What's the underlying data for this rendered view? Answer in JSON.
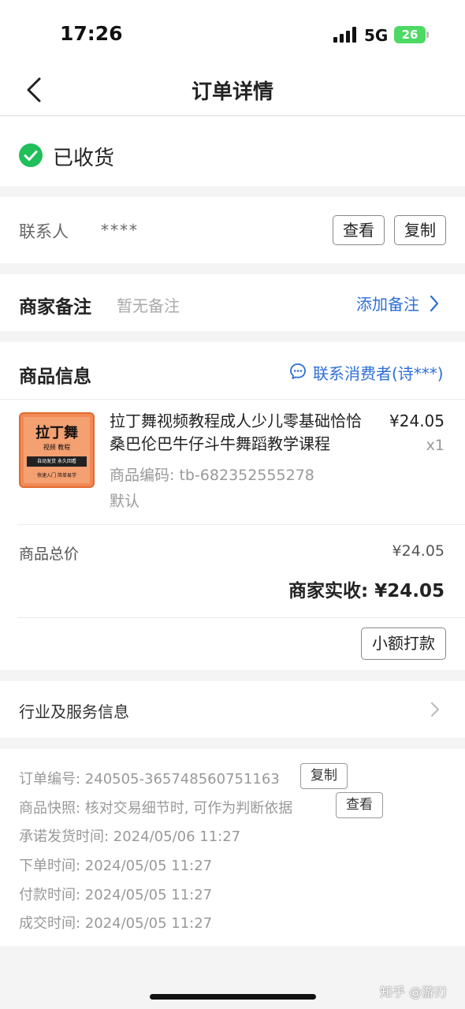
{
  "status_bar": {
    "time": "17:26",
    "network": "5G",
    "battery": "26"
  },
  "nav": {
    "title": "订单详情",
    "back_icon": "chevron-left-icon"
  },
  "order_status": {
    "label": "已收货",
    "icon": "check-circle-icon",
    "color": "#1fbf5a"
  },
  "contact": {
    "label": "联系人",
    "value": "****",
    "view_button": "查看",
    "copy_button": "复制"
  },
  "merchant_note": {
    "label": "商家备注",
    "value": "暂无备注",
    "add_link": "添加备注"
  },
  "goods": {
    "section_title": "商品信息",
    "contact_consumer": "联系消费者(诗***)",
    "thumbnail": {
      "title": "拉丁舞",
      "subtitle": "视频 教程",
      "bar": "自动发货  永久回看",
      "footer": "快速入门  简单易学"
    },
    "name": "拉丁舞视频教程成人少儿零基础恰恰桑巴伦巴牛仔斗牛舞蹈教学课程",
    "price": "¥24.05",
    "quantity": "x1",
    "code": "商品编码: tb-682352555278",
    "spec": "默认",
    "total_label": "商品总价",
    "total_value": "¥24.05",
    "merchant_received": "商家实收: ¥24.05",
    "small_payment_button": "小额打款"
  },
  "industry": {
    "label": "行业及服务信息"
  },
  "order_info": {
    "order_no": "订单编号: 240505-365748560751163",
    "order_no_copy": "复制",
    "snapshot": "商品快照: 核对交易细节时, 可作为判断依据",
    "snapshot_view": "查看",
    "promised_ship": "承诺发货时间: 2024/05/06 11:27",
    "order_time": "下单时间: 2024/05/05 11:27",
    "pay_time": "付款时间: 2024/05/05 11:27",
    "deal_time": "成交时间: 2024/05/05 11:27"
  },
  "watermark": "知乎 @游刃",
  "colors": {
    "accent": "#2e6fd6",
    "success": "#1fbf5a",
    "battery": "#4cd964"
  }
}
